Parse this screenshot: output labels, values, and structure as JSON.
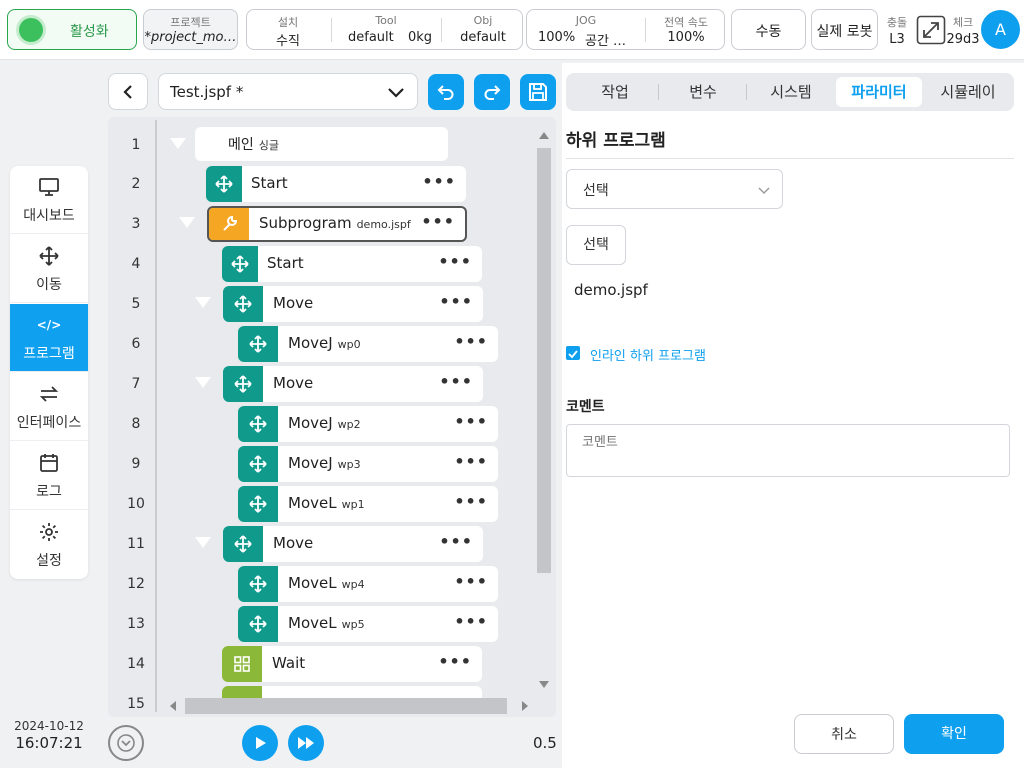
{
  "topbar": {
    "activate_label": "활성화",
    "project": {
      "label": "프로젝트",
      "value": "*project_mo…"
    },
    "setup": {
      "install_label": "설치",
      "install_value": "수직",
      "tool_label": "Tool",
      "tool_value": "default",
      "tool_weight": "0kg",
      "obj_label": "Obj",
      "obj_value": "default"
    },
    "jog": {
      "label": "JOG",
      "value": "100%",
      "space": "공간 …",
      "speed_label": "전역 속도",
      "speed_value": "100%"
    },
    "manual_label": "수동",
    "real_robot_label": "실제 로봇",
    "collision": {
      "label": "충돌",
      "value": "L3"
    },
    "check": {
      "label": "체크",
      "value": "29d3"
    },
    "avatar": "A"
  },
  "sidebar": {
    "items": [
      {
        "label": "대시보드",
        "icon": "monitor-icon"
      },
      {
        "label": "이동",
        "icon": "move-icon"
      },
      {
        "label": "프로그램",
        "icon": "code-icon"
      },
      {
        "label": "인터페이스",
        "icon": "swap-icon"
      },
      {
        "label": "로그",
        "icon": "calendar-icon"
      },
      {
        "label": "설정",
        "icon": "gear-icon"
      }
    ],
    "date": "2024-10-12",
    "time": "16:07:21"
  },
  "editor": {
    "filename": "Test.jspf *",
    "line_numbers": [
      "1",
      "2",
      "3",
      "4",
      "5",
      "6",
      "7",
      "8",
      "9",
      "10",
      "11",
      "12",
      "13",
      "14",
      "15"
    ],
    "nodes": [
      {
        "name": "메인",
        "sub": "싱글"
      },
      {
        "name": "Start",
        "sub": ""
      },
      {
        "name": "Subprogram",
        "sub": "demo.jspf"
      },
      {
        "name": "Start",
        "sub": ""
      },
      {
        "name": "Move",
        "sub": ""
      },
      {
        "name": "MoveJ",
        "sub": "wp0"
      },
      {
        "name": "Move",
        "sub": ""
      },
      {
        "name": "MoveJ",
        "sub": "wp2"
      },
      {
        "name": "MoveJ",
        "sub": "wp3"
      },
      {
        "name": "MoveL",
        "sub": "wp1"
      },
      {
        "name": "Move",
        "sub": ""
      },
      {
        "name": "MoveL",
        "sub": "wp4"
      },
      {
        "name": "MoveL",
        "sub": "wp5"
      },
      {
        "name": "Wait",
        "sub": ""
      }
    ],
    "speed_value": "0.5"
  },
  "panel": {
    "tabs": [
      "작업",
      "변수",
      "시스템",
      "파라미터",
      "시뮬레이"
    ],
    "active_tab": "파라미터",
    "title": "하위 프로그램",
    "select_placeholder": "선택",
    "select_button": "선택",
    "file": "demo.jspf",
    "inline_label": "인라인 하위 프로그램",
    "inline_checked": true,
    "comment_label": "코멘트",
    "comment_placeholder": "코멘트",
    "cancel_label": "취소",
    "confirm_label": "확인"
  },
  "colors": {
    "accent": "#0ea0ef",
    "move_node": "#0f9a8c",
    "subprogram_node": "#f5a623",
    "wait_node": "#8cb83a",
    "active_green": "#3cc05e"
  }
}
